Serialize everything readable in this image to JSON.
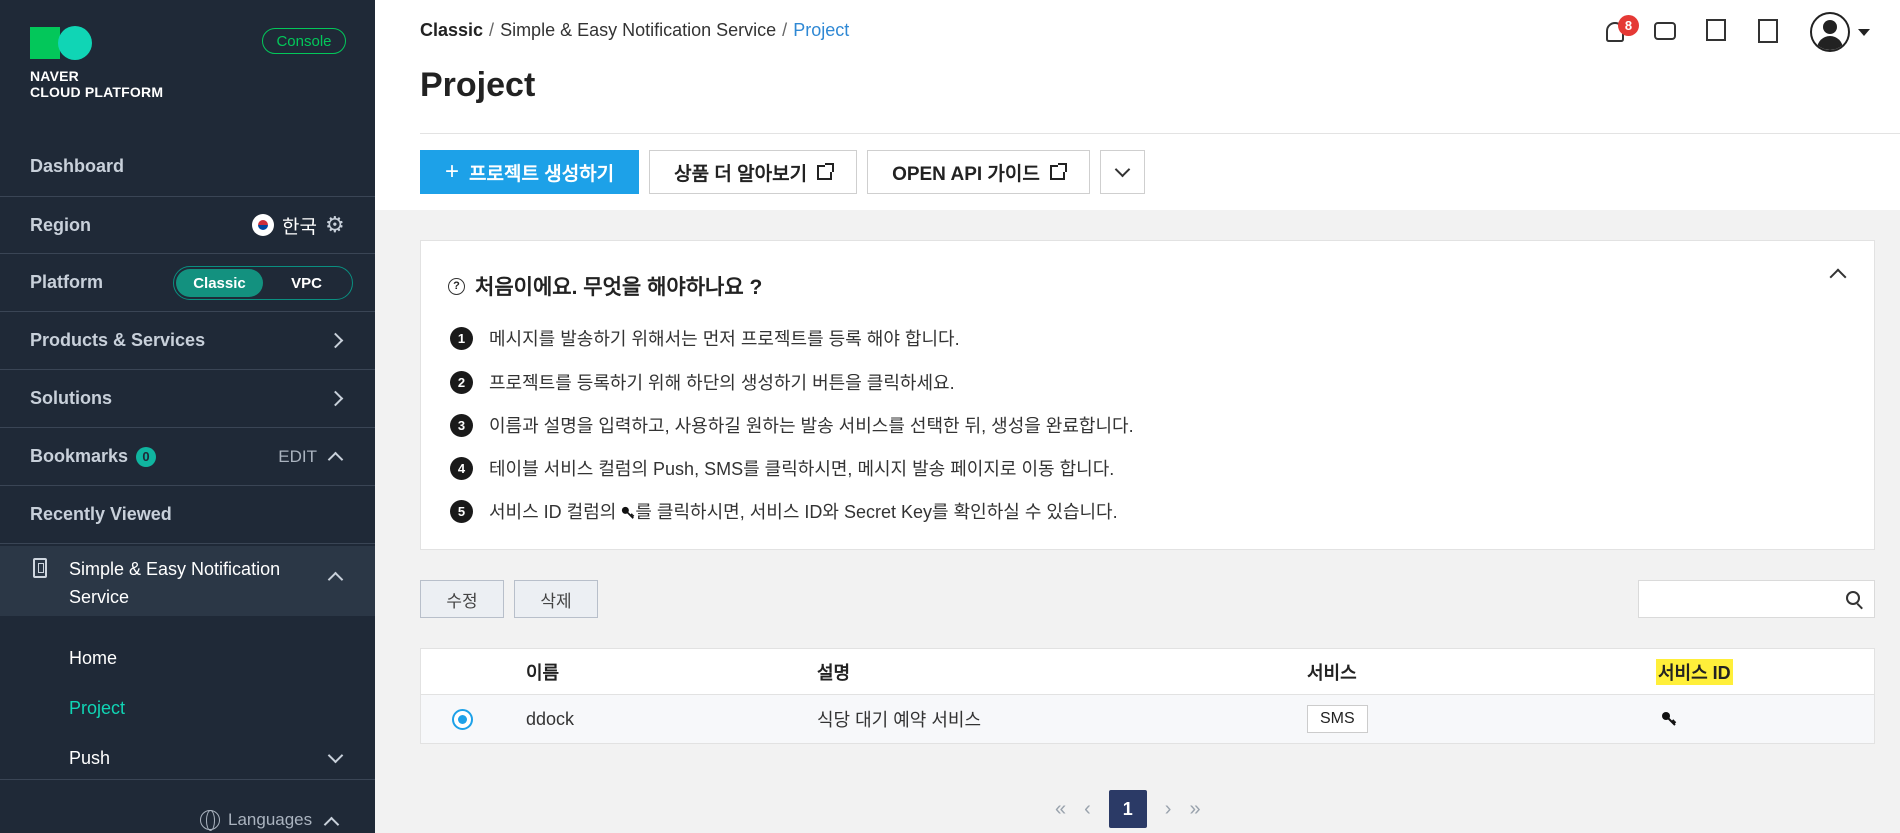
{
  "sidebar": {
    "logo_line1": "NAVER",
    "logo_line2": "CLOUD PLATFORM",
    "console_label": "Console",
    "dashboard": "Dashboard",
    "region_label": "Region",
    "region_value": "한국",
    "platform_label": "Platform",
    "platform_options": [
      "Classic",
      "VPC"
    ],
    "platform_selected": "Classic",
    "products": "Products & Services",
    "solutions": "Solutions",
    "bookmarks": "Bookmarks",
    "bookmarks_count": "0",
    "bookmarks_edit": "EDIT",
    "recently_viewed": "Recently Viewed",
    "service_title": "Simple & Easy Notification Service",
    "sub_items": [
      "Home",
      "Project",
      "Push"
    ],
    "active_sub": "Project",
    "languages": "Languages"
  },
  "header": {
    "breadcrumb": [
      "Classic",
      "Simple & Easy Notification Service",
      "Project"
    ],
    "separator": "/",
    "title": "Project",
    "notification_count": "8"
  },
  "toolbar": {
    "create_label": "프로젝트 생성하기",
    "create_prefix": "+",
    "learn_more_label": "상품 더 알아보기",
    "api_guide_label": "OPEN API 가이드"
  },
  "guide": {
    "title": "처음이에요. 무엇을 해야하나요 ?",
    "q_mark": "?",
    "steps": [
      "메시지를 발송하기 위해서는 먼저 프로젝트를 등록 해야 합니다.",
      "프로젝트를 등록하기 위해 하단의 생성하기 버튼을 클릭하세요.",
      "이름과 설명을 입력하고, 사용하길 원하는 발송 서비스를 선택한 뒤, 생성을 완료합니다.",
      "테이블 서비스 컬럼의 Push, SMS를 클릭하시면, 메시지 발송 페이지로 이동 합니다."
    ],
    "step5_before": "서비스 ID 컬럼의 ",
    "step5_after": "를 클릭하시면, 서비스 ID와 Secret Key를 확인하실 수 있습니다.",
    "step_numbers": [
      "1",
      "2",
      "3",
      "4",
      "5"
    ]
  },
  "actions": {
    "edit_label": "수정",
    "delete_label": "삭제",
    "search_value": ""
  },
  "table": {
    "headers": [
      "이름",
      "설명",
      "서비스",
      "서비스 ID"
    ],
    "rows": [
      {
        "name": "ddock",
        "description": "식당 대기 예약 서비스",
        "service": "SMS",
        "selected": true
      }
    ]
  },
  "pagination": {
    "current": "1",
    "first": "«",
    "prev": "‹",
    "next": "›",
    "last": "»"
  },
  "colors": {
    "sidebar_bg": "#1f2937",
    "accent_green": "#03c75a",
    "primary_blue": "#1da1e8",
    "active_teal": "#10d5b5",
    "highlight_yellow": "#ffef3a"
  }
}
